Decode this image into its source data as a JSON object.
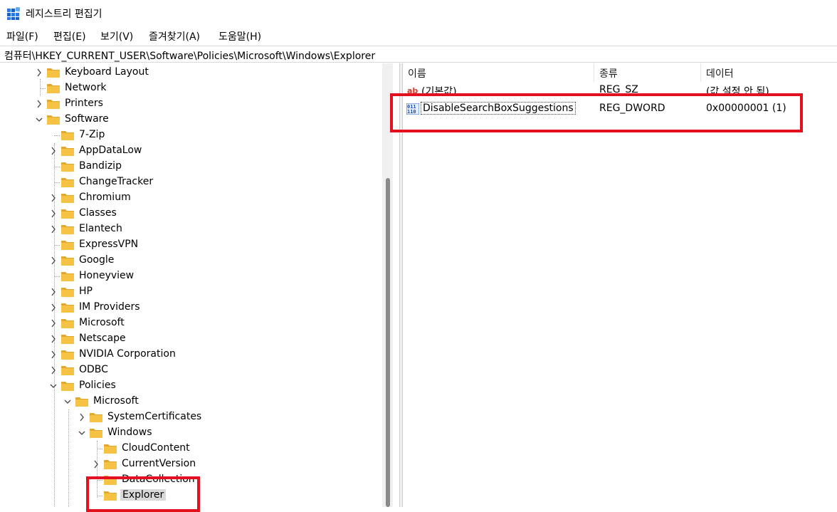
{
  "window": {
    "title": "레지스트리 편집기"
  },
  "menu": [
    {
      "label": "파일(F)"
    },
    {
      "label": "편집(E)"
    },
    {
      "label": "보기(V)"
    },
    {
      "label": "즐겨찾기(A)"
    },
    {
      "label": "도움말(H)"
    }
  ],
  "address": {
    "path": "컴퓨터\\HKEY_CURRENT_USER\\Software\\Policies\\Microsoft\\Windows\\Explorer"
  },
  "tree": [
    {
      "label": "Keyboard Layout",
      "chevron": "right"
    },
    {
      "label": "Network",
      "chevron": "none"
    },
    {
      "label": "Printers",
      "chevron": "right"
    },
    {
      "label": "Software",
      "chevron": "down"
    },
    {
      "label": "7-Zip",
      "chevron": "none"
    },
    {
      "label": "AppDataLow",
      "chevron": "right"
    },
    {
      "label": "Bandizip",
      "chevron": "none"
    },
    {
      "label": "ChangeTracker",
      "chevron": "none"
    },
    {
      "label": "Chromium",
      "chevron": "right"
    },
    {
      "label": "Classes",
      "chevron": "right"
    },
    {
      "label": "Elantech",
      "chevron": "right"
    },
    {
      "label": "ExpressVPN",
      "chevron": "none"
    },
    {
      "label": "Google",
      "chevron": "right"
    },
    {
      "label": "Honeyview",
      "chevron": "none"
    },
    {
      "label": "HP",
      "chevron": "right"
    },
    {
      "label": "IM Providers",
      "chevron": "right"
    },
    {
      "label": "Microsoft",
      "chevron": "right"
    },
    {
      "label": "Netscape",
      "chevron": "right"
    },
    {
      "label": "NVIDIA Corporation",
      "chevron": "right"
    },
    {
      "label": "ODBC",
      "chevron": "right"
    },
    {
      "label": "Policies",
      "chevron": "down"
    },
    {
      "label": "Microsoft",
      "chevron": "down"
    },
    {
      "label": "SystemCertificates",
      "chevron": "right"
    },
    {
      "label": "Windows",
      "chevron": "down"
    },
    {
      "label": "CloudContent",
      "chevron": "none"
    },
    {
      "label": "CurrentVersion",
      "chevron": "right"
    },
    {
      "label": "DataCollection",
      "chevron": "none"
    },
    {
      "label": "Explorer",
      "chevron": "none",
      "selected": true
    }
  ],
  "columns": {
    "name": "이름",
    "type": "종류",
    "data": "데이터"
  },
  "values": [
    {
      "name": "(기본값)",
      "type": "REG_SZ",
      "data": "(값 설정 안 됨)",
      "icon": "string-value-icon"
    },
    {
      "name": "DisableSearchBoxSuggestions",
      "type": "REG_DWORD",
      "data": "0x00000001 (1)",
      "icon": "dword-value-icon"
    }
  ],
  "colors": {
    "highlight": "#e3101f",
    "folder": "#f6c244"
  }
}
